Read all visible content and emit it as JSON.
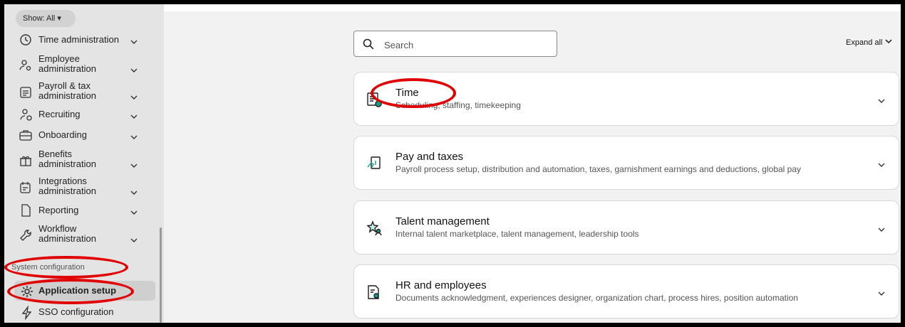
{
  "sidebar": {
    "show_filter": "Show: All",
    "items": [
      {
        "label": "Time administration",
        "icon": "clock-admin-icon"
      },
      {
        "label": "Employee administration",
        "icon": "people-gear-icon"
      },
      {
        "label": "Payroll & tax administration",
        "icon": "payroll-document-icon"
      },
      {
        "label": "Recruiting",
        "icon": "person-add-icon"
      },
      {
        "label": "Onboarding",
        "icon": "briefcase-icon"
      },
      {
        "label": "Benefits administration",
        "icon": "gift-icon"
      },
      {
        "label": "Integrations administration",
        "icon": "integrations-icon"
      },
      {
        "label": "Reporting",
        "icon": "file-icon"
      },
      {
        "label": "Workflow administration",
        "icon": "wrench-icon"
      }
    ],
    "section_label": "System configuration",
    "app_setup": "Application setup",
    "sso": "SSO configuration"
  },
  "search": {
    "placeholder": "Search"
  },
  "expand_all": "Expand all",
  "cards": [
    {
      "title": "Time",
      "subtitle": "Scheduling, staffing, timekeeping",
      "icon": "timesheet-icon"
    },
    {
      "title": "Pay and taxes",
      "subtitle": "Payroll process setup, distribution and automation, taxes, garnishment earnings and deductions, global pay",
      "icon": "hand-money-icon"
    },
    {
      "title": "Talent management",
      "subtitle": "Internal talent marketplace, talent management, leadership tools",
      "icon": "talent-star-icon"
    },
    {
      "title": "HR and employees",
      "subtitle": "Documents acknowledgment, experiences designer, organization chart, process hires, position automation",
      "icon": "hr-document-icon"
    }
  ],
  "colors": {
    "annotation": "#e00000",
    "accent": "#1a9e8e"
  }
}
